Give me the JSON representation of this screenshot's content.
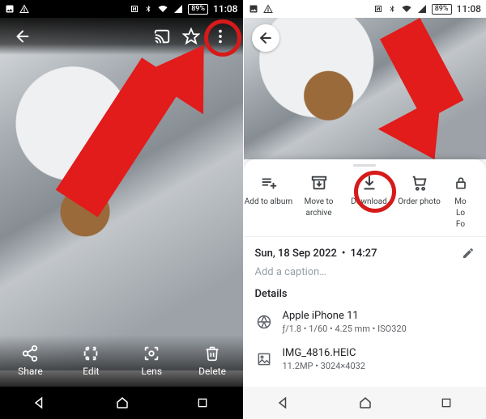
{
  "status": {
    "battery": "89%",
    "time": "11:08"
  },
  "left": {
    "bottom": {
      "share": "Share",
      "edit": "Edit",
      "lens": "Lens",
      "delete": "Delete"
    }
  },
  "right": {
    "sheet": {
      "add_album": "Add to album",
      "archive_l1": "Move to",
      "archive_l2": "archive",
      "download": "Download",
      "order": "Order photo",
      "more_l1": "Mo",
      "more_l2": "Lo",
      "more_l3": "Fo"
    },
    "meta": {
      "date": "Sun, 18 Sep 2022",
      "dot": "•",
      "time": "14:27",
      "caption_placeholder": "Add a caption…"
    },
    "details": {
      "heading": "Details",
      "device": "Apple iPhone 11",
      "exif": "ƒ/1.8 • 1/60 • 4.25 mm • ISO320",
      "filename": "IMG_4816.HEIC",
      "filemeta": "11.2MP • 3024×4032"
    }
  }
}
